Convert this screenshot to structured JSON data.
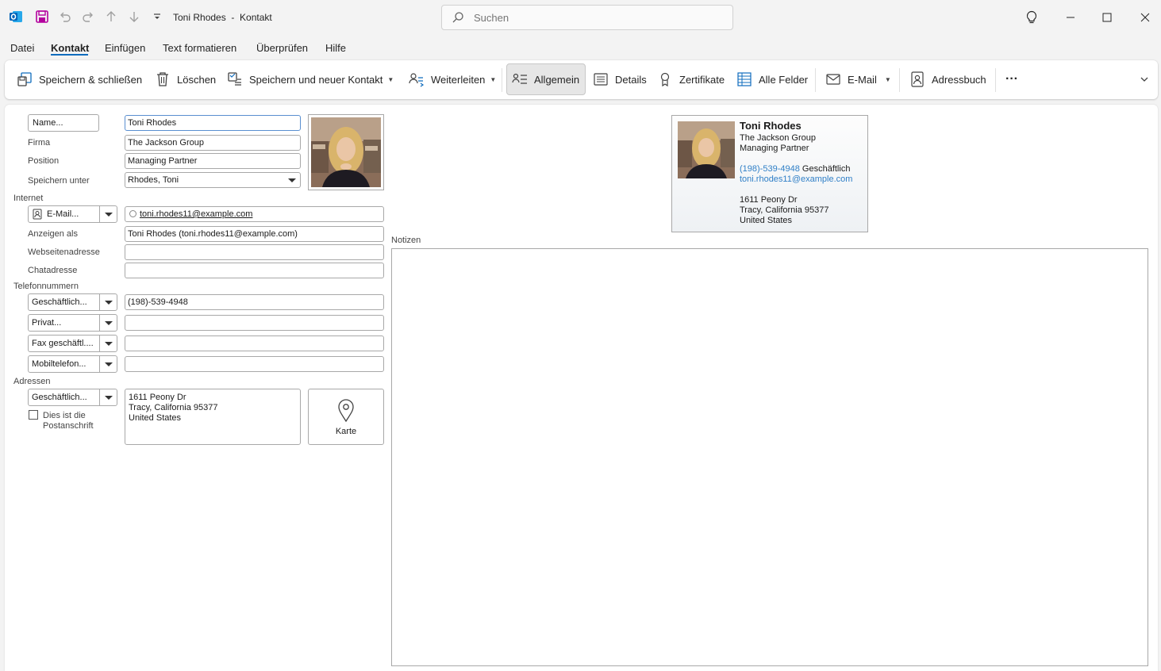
{
  "window": {
    "title": "Toni Rhodes  -  Kontakt",
    "search_placeholder": "Suchen"
  },
  "menu": {
    "items": [
      "Datei",
      "Kontakt",
      "Einfügen",
      "Text formatieren",
      "Überprüfen",
      "Hilfe"
    ],
    "active": "Kontakt"
  },
  "ribbon": {
    "save_close": "Speichern & schließen",
    "delete": "Löschen",
    "save_new": "Speichern und neuer Kontakt",
    "forward": "Weiterleiten",
    "general": "Allgemein",
    "details": "Details",
    "certificates": "Zertifikate",
    "all_fields": "Alle Felder",
    "email": "E-Mail",
    "address_book": "Adressbuch",
    "more": "···"
  },
  "form": {
    "name_button": "Name...",
    "name_value": "Toni Rhodes",
    "company_label": "Firma",
    "company_value": "The Jackson Group",
    "position_label": "Position",
    "position_value": "Managing Partner",
    "file_as_label": "Speichern unter",
    "file_as_value": "Rhodes, Toni",
    "internet_section": "Internet",
    "email_button": "E-Mail...",
    "email_value": "toni.rhodes11@example.com",
    "display_as_label": "Anzeigen als",
    "display_as_value": "Toni Rhodes (toni.rhodes11@example.com)",
    "web_label": "Webseitenadresse",
    "web_value": "",
    "chat_label": "Chatadresse",
    "chat_value": "",
    "phone_section": "Telefonnummern",
    "phone_business_label": "Geschäftlich...",
    "phone_business_value": "(198)-539-4948",
    "phone_home_label": "Privat...",
    "phone_home_value": "",
    "phone_fax_label": "Fax geschäftl....",
    "phone_fax_value": "",
    "phone_mobile_label": "Mobiltelefon...",
    "phone_mobile_value": "",
    "address_section": "Adressen",
    "address_type_label": "Geschäftlich...",
    "address_line1": "1611 Peony Dr",
    "address_line2": "Tracy, California  95377",
    "address_line3": "United States",
    "mailing_checkbox_label": "Dies ist die Postanschrift",
    "mailing_checked": false,
    "map_label": "Karte"
  },
  "card": {
    "name": "Toni Rhodes",
    "company": "The Jackson Group",
    "title": "Managing Partner",
    "phone": "(198)-539-4948",
    "phone_type": "Geschäftlich",
    "email": "toni.rhodes11@example.com",
    "address_line1": "1611 Peony Dr",
    "address_line2": "Tracy, California  95377",
    "address_line3": "United States"
  },
  "notes": {
    "label": "Notizen",
    "value": ""
  },
  "colors": {
    "accent": "#0f6cbd",
    "outlook_blue": "#0364b8",
    "save_purple": "#b4009e",
    "link": "#2f7fc7"
  }
}
